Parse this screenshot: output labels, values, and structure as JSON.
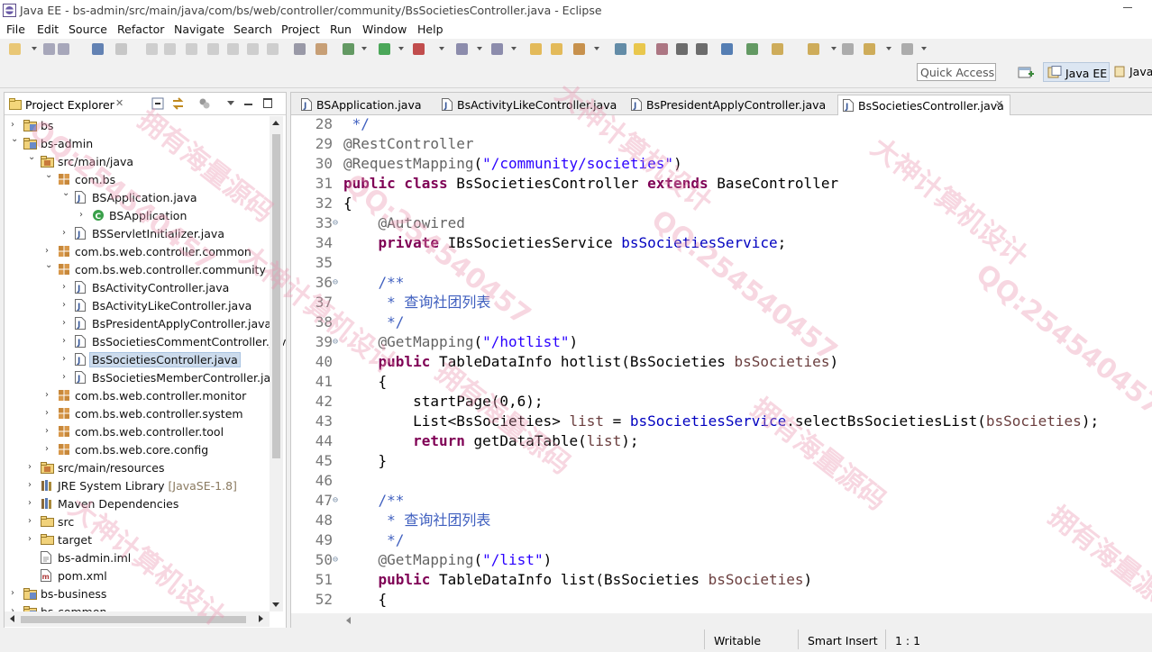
{
  "window": {
    "title": "Java EE - bs-admin/src/main/java/com/bs/web/controller/community/BsSocietiesController.java - Eclipse"
  },
  "menu": [
    "File",
    "Edit",
    "Source",
    "Refactor",
    "Navigate",
    "Search",
    "Project",
    "Run",
    "Window",
    "Help"
  ],
  "toolbar": {
    "quick_access_placeholder": "Quick Access",
    "perspectives": [
      "Java EE",
      "Java"
    ]
  },
  "explorer": {
    "title": "Project Explorer",
    "tree": [
      {
        "label": "bs",
        "depth": 0,
        "expanded": false,
        "icon": "project-icon"
      },
      {
        "label": "bs-admin",
        "depth": 0,
        "expanded": true,
        "icon": "project-icon"
      },
      {
        "label": "src/main/java",
        "depth": 1,
        "expanded": true,
        "icon": "source-folder-icon"
      },
      {
        "label": "com.bs",
        "depth": 2,
        "expanded": true,
        "icon": "package-icon"
      },
      {
        "label": "BSApplication.java",
        "depth": 3,
        "expanded": true,
        "icon": "java-file-icon"
      },
      {
        "label": "BSApplication",
        "depth": 4,
        "expanded": false,
        "icon": "class-icon"
      },
      {
        "label": "BSServletInitializer.java",
        "depth": 3,
        "expanded": false,
        "icon": "java-file-icon"
      },
      {
        "label": "com.bs.web.controller.common",
        "depth": 2,
        "expanded": false,
        "icon": "package-icon"
      },
      {
        "label": "com.bs.web.controller.community",
        "depth": 2,
        "expanded": true,
        "icon": "package-icon"
      },
      {
        "label": "BsActivityController.java",
        "depth": 3,
        "expanded": false,
        "icon": "java-file-icon"
      },
      {
        "label": "BsActivityLikeController.java",
        "depth": 3,
        "expanded": false,
        "icon": "java-file-icon"
      },
      {
        "label": "BsPresidentApplyController.java",
        "depth": 3,
        "expanded": false,
        "icon": "java-file-icon"
      },
      {
        "label": "BsSocietiesCommentController.jav",
        "depth": 3,
        "expanded": false,
        "icon": "java-file-icon"
      },
      {
        "label": "BsSocietiesController.java",
        "depth": 3,
        "expanded": false,
        "icon": "java-file-icon",
        "selected": true
      },
      {
        "label": "BsSocietiesMemberController.jav",
        "depth": 3,
        "expanded": false,
        "icon": "java-file-icon"
      },
      {
        "label": "com.bs.web.controller.monitor",
        "depth": 2,
        "expanded": false,
        "icon": "package-icon"
      },
      {
        "label": "com.bs.web.controller.system",
        "depth": 2,
        "expanded": false,
        "icon": "package-icon"
      },
      {
        "label": "com.bs.web.controller.tool",
        "depth": 2,
        "expanded": false,
        "icon": "package-icon"
      },
      {
        "label": "com.bs.web.core.config",
        "depth": 2,
        "expanded": false,
        "icon": "package-icon"
      },
      {
        "label": "src/main/resources",
        "depth": 1,
        "expanded": false,
        "icon": "source-folder-icon"
      },
      {
        "label": "JRE System Library",
        "sub": " [JavaSE-1.8]",
        "depth": 1,
        "expanded": false,
        "icon": "library-icon"
      },
      {
        "label": "Maven Dependencies",
        "depth": 1,
        "expanded": false,
        "icon": "library-icon"
      },
      {
        "label": "src",
        "depth": 1,
        "expanded": false,
        "icon": "folder-icon"
      },
      {
        "label": "target",
        "depth": 1,
        "expanded": false,
        "icon": "folder-icon"
      },
      {
        "label": "bs-admin.iml",
        "depth": 1,
        "leaf": true,
        "icon": "file-icon"
      },
      {
        "label": "pom.xml",
        "depth": 1,
        "leaf": true,
        "icon": "xml-file-icon"
      },
      {
        "label": "bs-business",
        "depth": 0,
        "expanded": false,
        "icon": "project-icon"
      },
      {
        "label": "bs-common",
        "depth": 0,
        "expanded": false,
        "icon": "project-icon"
      }
    ]
  },
  "editor": {
    "tabs": [
      "BSApplication.java",
      "BsActivityLikeController.java",
      "BsPresidentApplyController.java",
      "BsSocietiesController.java"
    ],
    "active_tab": 3,
    "lines": [
      {
        "n": "28",
        "fold": false,
        "tokens": [
          [
            "cm",
            " */"
          ]
        ]
      },
      {
        "n": "29",
        "fold": false,
        "tokens": [
          [
            "an",
            "@RestController"
          ]
        ]
      },
      {
        "n": "30",
        "fold": false,
        "tokens": [
          [
            "an",
            "@RequestMapping"
          ],
          [
            "",
            "("
          ],
          [
            "st",
            "\"/community/societies\""
          ],
          [
            "",
            ")"
          ]
        ]
      },
      {
        "n": "31",
        "fold": false,
        "tokens": [
          [
            "kw",
            "public class"
          ],
          [
            "",
            " BsSocietiesController "
          ],
          [
            "kw",
            "extends"
          ],
          [
            "",
            " BaseController"
          ]
        ]
      },
      {
        "n": "32",
        "fold": false,
        "tokens": [
          [
            "",
            "{"
          ]
        ]
      },
      {
        "n": "33",
        "fold": true,
        "tokens": [
          [
            "an",
            "    @Autowired"
          ]
        ]
      },
      {
        "n": "34",
        "fold": false,
        "tokens": [
          [
            "kw",
            "    private"
          ],
          [
            "",
            " IBsSocietiesService "
          ],
          [
            "fld",
            "bsSocietiesService"
          ],
          [
            "",
            ";"
          ]
        ]
      },
      {
        "n": "35",
        "fold": false,
        "tokens": []
      },
      {
        "n": "36",
        "fold": true,
        "tokens": [
          [
            "cm",
            "    /**"
          ]
        ]
      },
      {
        "n": "37",
        "fold": false,
        "tokens": [
          [
            "cm",
            "     * 查询社团列表"
          ]
        ]
      },
      {
        "n": "38",
        "fold": false,
        "tokens": [
          [
            "cm",
            "     */"
          ]
        ]
      },
      {
        "n": "39",
        "fold": true,
        "tokens": [
          [
            "an",
            "    @GetMapping"
          ],
          [
            "",
            "("
          ],
          [
            "st",
            "\"/hotlist\""
          ],
          [
            "",
            ")"
          ]
        ]
      },
      {
        "n": "40",
        "fold": false,
        "tokens": [
          [
            "kw",
            "    public"
          ],
          [
            "",
            " TableDataInfo hotlist(BsSocieties "
          ],
          [
            "pm",
            "bsSocieties"
          ],
          [
            "",
            ")"
          ]
        ]
      },
      {
        "n": "41",
        "fold": false,
        "tokens": [
          [
            "",
            "    {"
          ]
        ]
      },
      {
        "n": "42",
        "fold": false,
        "tokens": [
          [
            "",
            "        startPage(0,6);"
          ]
        ]
      },
      {
        "n": "43",
        "fold": false,
        "tokens": [
          [
            "",
            "        List<BsSocieties> "
          ],
          [
            "pm",
            "list"
          ],
          [
            "",
            " = "
          ],
          [
            "fld",
            "bsSocietiesService"
          ],
          [
            "",
            ".selectBsSocietiesList("
          ],
          [
            "pm",
            "bsSocieties"
          ],
          [
            "",
            ");"
          ]
        ]
      },
      {
        "n": "44",
        "fold": false,
        "tokens": [
          [
            "kw",
            "        return"
          ],
          [
            "",
            " getDataTable("
          ],
          [
            "pm",
            "list"
          ],
          [
            "",
            ");"
          ]
        ]
      },
      {
        "n": "45",
        "fold": false,
        "tokens": [
          [
            "",
            "    }"
          ]
        ]
      },
      {
        "n": "46",
        "fold": false,
        "tokens": []
      },
      {
        "n": "47",
        "fold": true,
        "tokens": [
          [
            "cm",
            "    /**"
          ]
        ]
      },
      {
        "n": "48",
        "fold": false,
        "tokens": [
          [
            "cm",
            "     * 查询社团列表"
          ]
        ]
      },
      {
        "n": "49",
        "fold": false,
        "tokens": [
          [
            "cm",
            "     */"
          ]
        ]
      },
      {
        "n": "50",
        "fold": true,
        "tokens": [
          [
            "an",
            "    @GetMapping"
          ],
          [
            "",
            "("
          ],
          [
            "st",
            "\"/list\""
          ],
          [
            "",
            ")"
          ]
        ]
      },
      {
        "n": "51",
        "fold": false,
        "tokens": [
          [
            "kw",
            "    public"
          ],
          [
            "",
            " TableDataInfo list(BsSocieties "
          ],
          [
            "pm",
            "bsSocieties"
          ],
          [
            "",
            ")"
          ]
        ]
      },
      {
        "n": "52",
        "fold": false,
        "tokens": [
          [
            "",
            "    {"
          ]
        ]
      }
    ]
  },
  "statusbar": {
    "writable": "Writable",
    "insert_mode": "Smart Insert",
    "position": "1 : 1"
  },
  "watermark": [
    "QQ:254540457",
    "拥有海量源码",
    "大神计算机设计",
    "QQ:254540457",
    "拥有海量源码",
    "大神计算机设计",
    "QQ:254540457",
    "拥有海量源码",
    "大神计算机设计",
    "QQ:254540457",
    "拥有海量源码",
    "大神计算机设计"
  ]
}
